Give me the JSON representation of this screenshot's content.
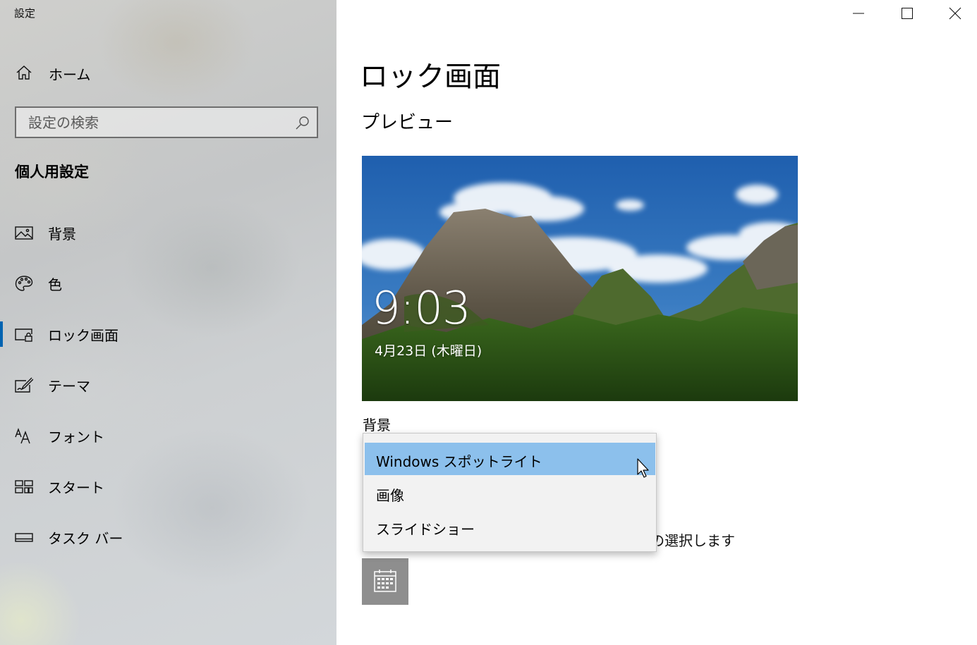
{
  "window": {
    "app_title": "設定"
  },
  "sidebar": {
    "home_label": "ホーム",
    "search_placeholder": "設定の検索",
    "section_title": "個人用設定",
    "items": [
      {
        "label": "背景"
      },
      {
        "label": "色"
      },
      {
        "label": "ロック画面"
      },
      {
        "label": "テーマ"
      },
      {
        "label": "フォント"
      },
      {
        "label": "スタート"
      },
      {
        "label": "タスク バー"
      }
    ],
    "active_index": 2
  },
  "main": {
    "page_title": "ロック画面",
    "preview_title": "プレビュー",
    "preview": {
      "time": "9:03",
      "date": "4月23日 (木曜日)"
    },
    "background_label": "背景",
    "behind_dropdown_text": "の選択します",
    "dropdown": {
      "options": [
        "Windows スポットライト",
        "画像",
        "スライドショー"
      ],
      "selected_index": 0
    }
  },
  "colors": {
    "accent": "#0063b1",
    "dropdown_highlight": "#8cc0ec",
    "tile_gray": "#8e8e8e"
  },
  "icons": {
    "home": "home-icon",
    "search": "search-icon",
    "background": "picture-icon",
    "color": "palette-icon",
    "lock_screen": "lock-screen-icon",
    "theme": "theme-brush-icon",
    "font": "font-icon",
    "start": "start-tiles-icon",
    "taskbar": "taskbar-icon",
    "calendar": "calendar-icon",
    "minimize": "minimize-icon",
    "maximize": "maximize-icon",
    "close": "close-icon"
  }
}
